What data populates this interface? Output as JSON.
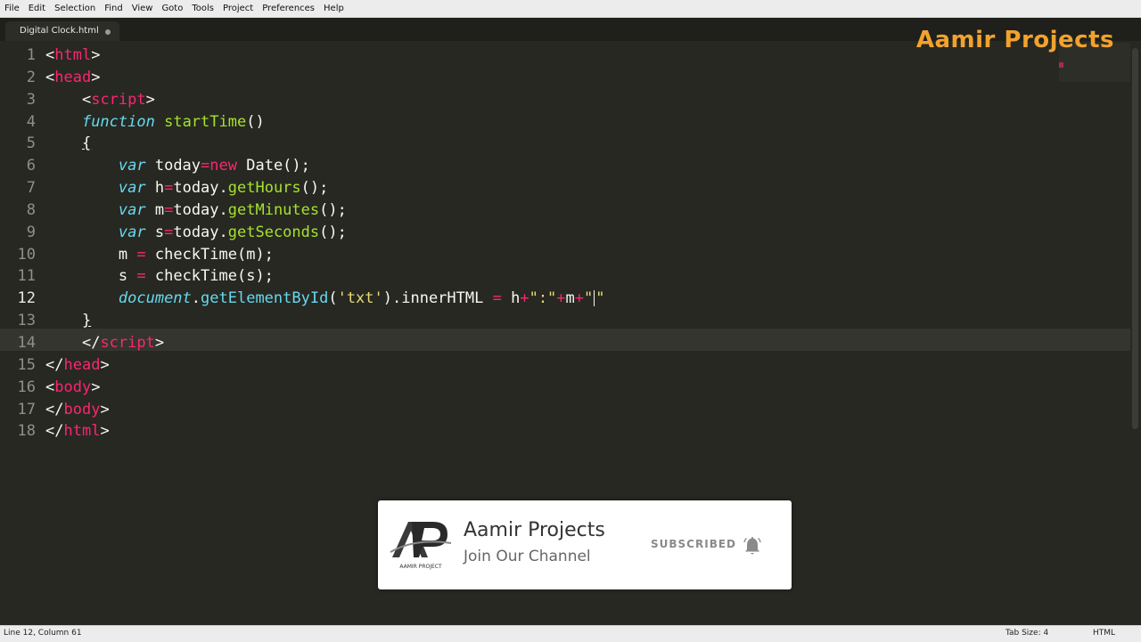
{
  "menu": [
    "File",
    "Edit",
    "Selection",
    "Find",
    "View",
    "Goto",
    "Tools",
    "Project",
    "Preferences",
    "Help"
  ],
  "tab": {
    "title": "Digital Clock.html"
  },
  "watermark": "Aamir Projects",
  "line_numbers": [
    "1",
    "2",
    "3",
    "4",
    "5",
    "6",
    "7",
    "8",
    "9",
    "10",
    "11",
    "12",
    "13",
    "14",
    "15",
    "16",
    "17",
    "18"
  ],
  "current_line": 12,
  "code": {
    "l1": {
      "lt": "<",
      "tag": "html",
      "gt": ">"
    },
    "l2": {
      "lt": "<",
      "tag": "head",
      "gt": ">"
    },
    "l3": {
      "lt": "<",
      "tag": "script",
      "gt": ">"
    },
    "l4": {
      "kw": "function",
      "name": "startTime",
      "rest": "()"
    },
    "l5": {
      "brace": "{"
    },
    "l6": {
      "kw": "var",
      "a": " today",
      "eq": "=",
      "kw2": "new",
      "b": " Date();"
    },
    "l7": {
      "kw": "var",
      "a": " h",
      "eq": "=",
      "b": "today.",
      "fn": "getHours",
      "c": "();"
    },
    "l8": {
      "kw": "var",
      "a": " m",
      "eq": "=",
      "b": "today.",
      "fn": "getMinutes",
      "c": "();"
    },
    "l9": {
      "kw": "var",
      "a": " s",
      "eq": "=",
      "b": "today.",
      "fn": "getSeconds",
      "c": "();"
    },
    "l10": {
      "a": "m ",
      "eq": "=",
      "b": " checkTime(m);"
    },
    "l11": {
      "a": "s ",
      "eq": "=",
      "b": " checkTime(s);"
    },
    "l12": {
      "doc": "document",
      "dot": ".",
      "fn": "getElementById",
      "po": "(",
      "str": "'txt'",
      "pc": ").innerHTML ",
      "eq": "=",
      "h": " h",
      "p1": "+",
      "s1": "\":\"",
      "p2": "+",
      "m": "m",
      "p3": "+",
      "s2a": "\"",
      "s2b": "\""
    },
    "l13": {
      "brace": "}"
    },
    "l14": {
      "lt": "</",
      "tag": "script",
      "gt": ">"
    },
    "l15": {
      "lt": "</",
      "tag": "head",
      "gt": ">"
    },
    "l16": {
      "lt": "<",
      "tag": "body",
      "gt": ">"
    },
    "l17": {
      "lt": "</",
      "tag": "body",
      "gt": ">"
    },
    "l18": {
      "lt": "</",
      "tag": "html",
      "gt": ">"
    }
  },
  "subscribe": {
    "channel": "Aamir Projects",
    "tagline": "Join Our Channel",
    "button": "SUBSCRIBED",
    "logo_text": "AP",
    "logo_caption": "AAMIR PROJECT"
  },
  "status": {
    "position": "Line 12, Column 61",
    "tab_size": "Tab Size: 4",
    "syntax": "HTML"
  },
  "colors": {
    "background": "#272822",
    "tag": "#f92672",
    "keyword": "#66d9ef",
    "function": "#a6e22e",
    "string": "#e6db74",
    "brand": "#f2a22e"
  }
}
